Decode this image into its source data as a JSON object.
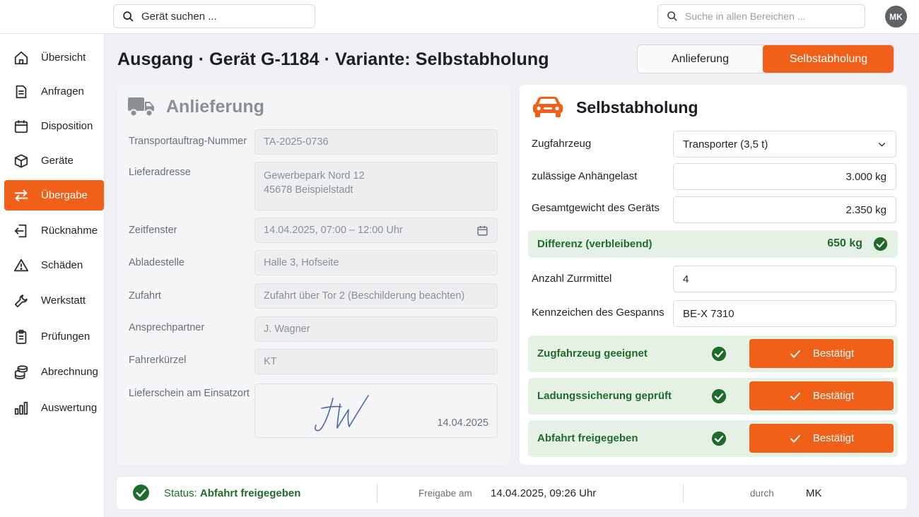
{
  "topbar": {
    "device_search_placeholder": "Gerät suchen ...",
    "global_search_placeholder": "Suche in allen Bereichen ...",
    "avatar_initials": "MK"
  },
  "sidebar": {
    "items": [
      {
        "label": "Übersicht",
        "icon": "home-icon"
      },
      {
        "label": "Anfragen",
        "icon": "document-icon"
      },
      {
        "label": "Disposition",
        "icon": "calendar-icon"
      },
      {
        "label": "Geräte",
        "icon": "box-icon"
      },
      {
        "label": "Übergabe",
        "icon": "swap-arrows-icon",
        "active": true
      },
      {
        "label": "Rücknahme",
        "icon": "return-icon"
      },
      {
        "label": "Schäden",
        "icon": "warning-icon"
      },
      {
        "label": "Werkstatt",
        "icon": "wrench-icon"
      },
      {
        "label": "Prüfungen",
        "icon": "clipboard-icon"
      },
      {
        "label": "Abrechnung",
        "icon": "coins-icon"
      },
      {
        "label": "Auswertung",
        "icon": "bar-chart-icon"
      }
    ]
  },
  "header": {
    "title": "Ausgang · Gerät G-1184 · Variante: Selbstabholung",
    "toggle": {
      "option_delivery": "Anlieferung",
      "option_pickup": "Selbstabholung",
      "selected": "Selbstabholung"
    }
  },
  "delivery_panel": {
    "heading": "Anlieferung",
    "fields": {
      "order_number_label": "Transportauftrag-Nummer",
      "order_number_value": "TA-2025-0736",
      "address_label": "Lieferadresse",
      "address_line1": "Gewerbepark Nord 12",
      "address_line2": "45678 Beispielstadt",
      "timewindow_label": "Zeitfenster",
      "timewindow_value": "14.04.2025, 07:00 – 12:00 Uhr",
      "unloading_label": "Abladestelle",
      "unloading_value": "Halle 3, Hofseite",
      "access_label": "Zufahrt",
      "access_value": "Zufahrt über Tor 2 (Beschilderung beachten)",
      "contact_label": "Ansprechpartner",
      "contact_value": "J. Wagner",
      "driver_label": "Fahrerkürzel",
      "driver_value": "KT",
      "delivery_note_label": "Lieferschein am Einsatzort",
      "delivery_note_date": "14.04.2025"
    }
  },
  "pickup_panel": {
    "heading": "Selbstabholung",
    "towing_vehicle_label": "Zugfahrzeug",
    "towing_vehicle_value": "Transporter (3,5 t)",
    "trailer_load_label": "zulässige Anhängelast",
    "trailer_load_value": "3.000 kg",
    "device_weight_label": "Gesamtgewicht des Geräts",
    "device_weight_value": "2.350 kg",
    "difference_label": "Differenz (verbleibend)",
    "difference_value": "650 kg",
    "lashing_label": "Anzahl Zurrmittel",
    "lashing_value": "4",
    "plate_label": "Kennzeichen des Gespanns",
    "plate_value": "BE-X 7310",
    "confirmations": [
      {
        "label": "Zugfahrzeug geeignet",
        "button": "Bestätigt"
      },
      {
        "label": "Ladungssicherung geprüft",
        "button": "Bestätigt"
      },
      {
        "label": "Abfahrt freigegeben",
        "button": "Bestätigt"
      }
    ]
  },
  "statusbar": {
    "status_prefix": "Status:",
    "status_value": "Abfahrt freigegeben",
    "release_label": "Freigabe am",
    "release_value": "14.04.2025, 09:26 Uhr",
    "by_label": "durch",
    "by_value": "MK"
  },
  "colors": {
    "accent": "#f06018",
    "success": "#1f6b2a",
    "success_bg": "#e6f1e6"
  }
}
